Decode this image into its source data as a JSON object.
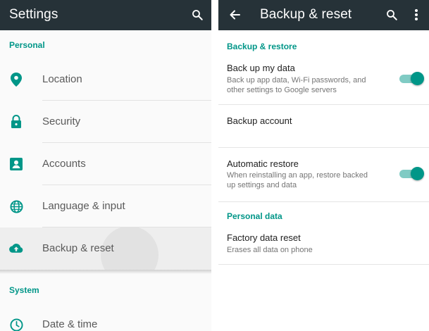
{
  "settings": {
    "title": "Settings",
    "search_icon": "search-icon",
    "personal_header": "Personal",
    "items": [
      {
        "label": "Location",
        "icon": "location-pin-icon"
      },
      {
        "label": "Security",
        "icon": "lock-icon"
      },
      {
        "label": "Accounts",
        "icon": "account-box-icon"
      },
      {
        "label": "Language & input",
        "icon": "globe-icon"
      },
      {
        "label": "Backup & reset",
        "icon": "cloud-upload-icon"
      }
    ],
    "system_header": "System",
    "system_items": [
      {
        "label": "Date & time",
        "icon": "clock-icon"
      }
    ]
  },
  "backup": {
    "title": "Backup & reset",
    "back_icon": "arrow-back-icon",
    "search_icon": "search-icon",
    "more_icon": "more-vert-icon",
    "restore_header": "Backup & restore",
    "backup_data": {
      "title": "Back up my data",
      "subtitle": "Back up app data, Wi-Fi passwords, and other settings to Google servers",
      "enabled": true
    },
    "backup_account": {
      "title": "Backup account"
    },
    "auto_restore": {
      "title": "Automatic restore",
      "subtitle": "When reinstalling an app, restore backed up settings and data",
      "enabled": true
    },
    "personal_header": "Personal data",
    "factory_reset": {
      "title": "Factory data reset",
      "subtitle": "Erases all data on phone"
    }
  },
  "colors": {
    "appbar": "#263238",
    "accent": "#009688",
    "track": "#80cbc4"
  }
}
